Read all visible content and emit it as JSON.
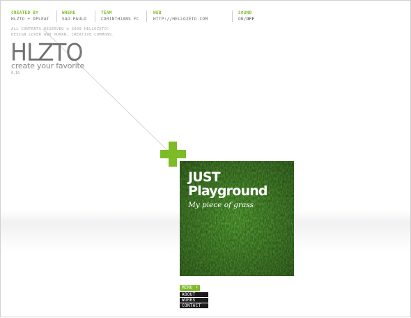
{
  "info_bar": [
    {
      "label": "CREATED BY",
      "value": "HLZTO + DPLEAT"
    },
    {
      "label": "WHERE",
      "value": "SAO PAULO"
    },
    {
      "label": "TEAM",
      "value": "CORINTHIANS FC"
    },
    {
      "label": "WEB",
      "value": "HTTP://HELLOZETO.COM"
    }
  ],
  "sound": {
    "label": "SOUND",
    "on": "ON",
    "separator": "/",
    "off": "OFF"
  },
  "copyright": {
    "line1": "ALL CONTENTS RESERVED © 2009 HELLOZETO!",
    "line2": "DESIGN LOVER AND HUMAN, CREATIVE COMMONS."
  },
  "logo": {
    "mark": "HLZTO",
    "tagline": "create your favorite",
    "version": "0.10"
  },
  "card": {
    "title_line1": "JUST",
    "title_line2": "Playground",
    "subtitle": "My piece of grass"
  },
  "menu": {
    "toggle_label": "MENU +",
    "items": [
      "ABOUT",
      "WORKS",
      "CONTACT"
    ]
  },
  "colors": {
    "accent": "#7dbb27",
    "grass": "#2f6d17",
    "menu_bg": "#1b1b1b"
  },
  "icons": {
    "plus": "plus-icon"
  }
}
